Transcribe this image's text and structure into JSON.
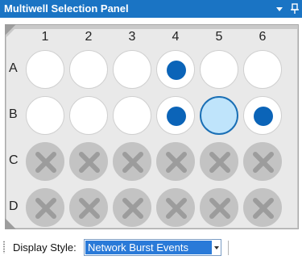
{
  "window": {
    "title": "Multiwell Selection Panel",
    "menu_icon": "dropdown-arrow-icon",
    "pin_icon": "pin-icon"
  },
  "plate": {
    "columns": [
      "1",
      "2",
      "3",
      "4",
      "5",
      "6"
    ],
    "rows": [
      {
        "label": "A",
        "wells": [
          "empty",
          "empty",
          "empty",
          "active",
          "empty",
          "empty"
        ]
      },
      {
        "label": "B",
        "wells": [
          "empty",
          "empty",
          "empty",
          "active",
          "selected",
          "active"
        ]
      },
      {
        "label": "C",
        "wells": [
          "disabled",
          "disabled",
          "disabled",
          "disabled",
          "disabled",
          "disabled"
        ]
      },
      {
        "label": "D",
        "wells": [
          "disabled",
          "disabled",
          "disabled",
          "disabled",
          "disabled",
          "disabled"
        ]
      }
    ],
    "colors": {
      "active_dot": "#0b64b8",
      "selected_fill": "#bfe4fb",
      "selected_border": "#1a6fb5",
      "disabled_fill": "#c3c3c3",
      "disabled_x": "#9c9c9c"
    }
  },
  "toolbar": {
    "display_style_label": "Display Style:",
    "display_style_value": "Network Burst Events"
  },
  "theme": {
    "titlebar": "#1a74c4",
    "selection": "#2a7ad8"
  }
}
